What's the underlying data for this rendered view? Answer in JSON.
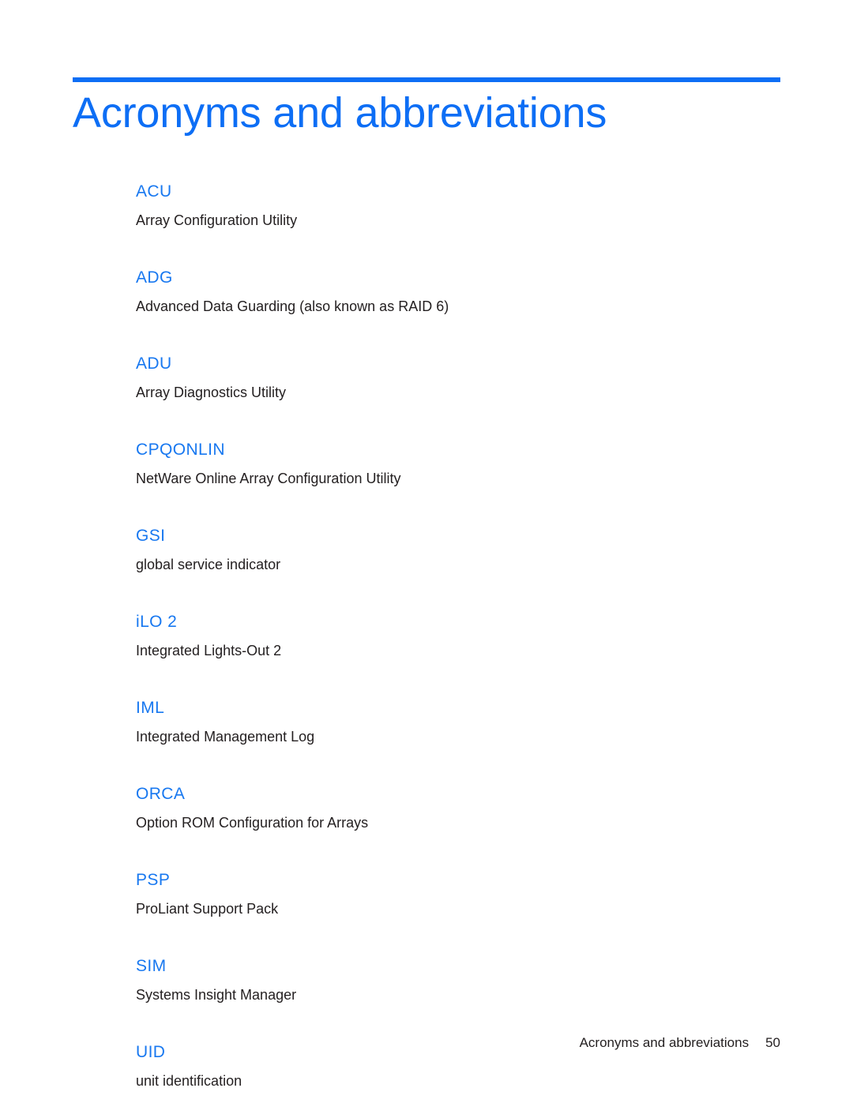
{
  "document": {
    "heading": "Acronyms and abbreviations",
    "accent_color": "#0d6ef5",
    "term_color": "#1878f0",
    "body_color": "#231f20",
    "background_color": "#ffffff"
  },
  "glossary": [
    {
      "term": "ACU",
      "definition": "Array Configuration Utility"
    },
    {
      "term": "ADG",
      "definition": "Advanced Data Guarding (also known as RAID 6)"
    },
    {
      "term": "ADU",
      "definition": "Array Diagnostics Utility"
    },
    {
      "term": "CPQONLIN",
      "definition": "NetWare Online Array Configuration Utility"
    },
    {
      "term": "GSI",
      "definition": "global service indicator"
    },
    {
      "term": "iLO 2",
      "definition": "Integrated Lights-Out 2"
    },
    {
      "term": "IML",
      "definition": "Integrated Management Log"
    },
    {
      "term": "ORCA",
      "definition": "Option ROM Configuration for Arrays"
    },
    {
      "term": "PSP",
      "definition": "ProLiant Support Pack"
    },
    {
      "term": "SIM",
      "definition": "Systems Insight Manager"
    },
    {
      "term": "UID",
      "definition": "unit identification"
    }
  ],
  "footer": {
    "title": "Acronyms and abbreviations",
    "page_number": "50"
  }
}
